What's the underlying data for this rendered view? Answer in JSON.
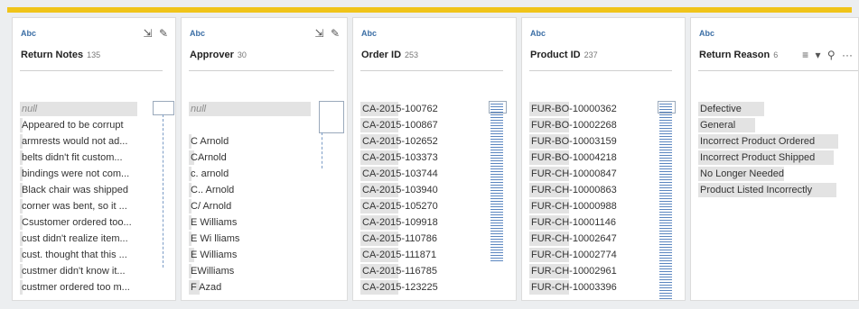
{
  "panels": [
    {
      "type": "Abc",
      "name": "Return Notes",
      "count": "135",
      "values": [
        "null",
        "Appeared to be corrupt",
        "armrests would not ad...",
        "belts didn't fit custom...",
        "bindings were not com...",
        "Black chair was shipped",
        "corner was bent, so it ...",
        "Csustomer ordered too...",
        "cust didn't realize item...",
        "cust. thought that this ...",
        "custmer didn't know it...",
        "custmer ordered too m..."
      ]
    },
    {
      "type": "Abc",
      "name": "Approver",
      "count": "30",
      "values": [
        "null",
        "",
        "C Arnold",
        "CArnold",
        "c. arnold",
        "C.. Arnold",
        "C/ Arnold",
        "E  Williams",
        "E Wi lliams",
        "E Williams",
        "EWilliams",
        "F Azad"
      ]
    },
    {
      "type": "Abc",
      "name": "Order ID",
      "count": "253",
      "values": [
        "CA-2015-100762",
        "CA-2015-100867",
        "CA-2015-102652",
        "CA-2015-103373",
        "CA-2015-103744",
        "CA-2015-103940",
        "CA-2015-105270",
        "CA-2015-109918",
        "CA-2015-110786",
        "CA-2015-111871",
        "CA-2015-116785",
        "CA-2015-123225"
      ]
    },
    {
      "type": "Abc",
      "name": "Product ID",
      "count": "237",
      "values": [
        "FUR-BO-10000362",
        "FUR-BO-10002268",
        "FUR-BO-10003159",
        "FUR-BO-10004218",
        "FUR-CH-10000847",
        "FUR-CH-10000863",
        "FUR-CH-10000988",
        "FUR-CH-10001146",
        "FUR-CH-10002647",
        "FUR-CH-10002774",
        "FUR-CH-10002961",
        "FUR-CH-10003396"
      ]
    },
    {
      "type": "Abc",
      "name": "Return Reason",
      "count": "6",
      "values": [
        "Defective",
        "General",
        "Incorrect Product Ordered",
        "Incorrect Product Shipped",
        "No Longer Needed",
        "Product Listed Incorrectly"
      ],
      "shares": [
        0.46,
        0.4,
        0.98,
        0.95,
        0.6,
        0.97
      ]
    }
  ],
  "icons": {
    "export": "export-icon",
    "edit": "edit-icon",
    "sort": "sort-icon",
    "dropdown": "chevron-down-icon",
    "search": "search-icon",
    "more": "more-icon"
  },
  "glyphs": {
    "export": "⇲",
    "edit": "✎",
    "sort": "≡",
    "dropdown": "▾",
    "search": "⚲",
    "more": "···"
  },
  "accent": "#f0c419"
}
